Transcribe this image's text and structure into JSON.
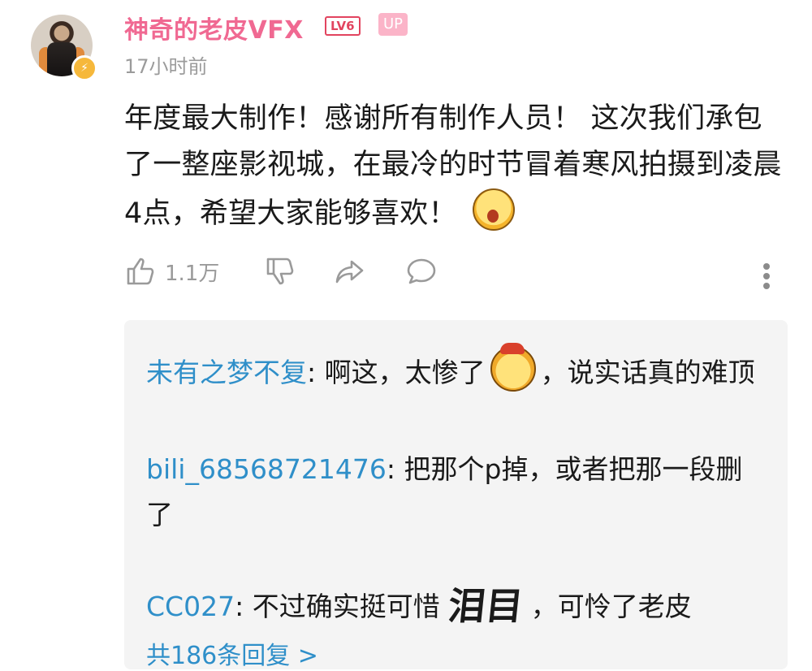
{
  "comment": {
    "username": "神奇的老皮VFX",
    "level": "LV6",
    "up_badge": "UP",
    "time": "17小时前",
    "content": "年度最大制作！感谢所有制作人员！ 这次我们承包了一整座影视城，在最冷的时节冒着寒风拍摄到凌晨4点，希望大家能够喜欢！",
    "like_count": "1.1万",
    "avatar_badge_icon": "lightning-icon"
  },
  "replies": [
    {
      "name": "未有之梦不复",
      "text_before": "啊这，太惨了",
      "text_after": "，说实话真的难顶"
    },
    {
      "name": "bili_68568721476",
      "text": "把那个p掉，或者把那一段删了"
    },
    {
      "name": "CC027",
      "text_before": "不过确实挺可惜",
      "sticker_text": "泪目",
      "text_after": "，可怜了老皮"
    }
  ],
  "more_replies": "共186条回复 >"
}
